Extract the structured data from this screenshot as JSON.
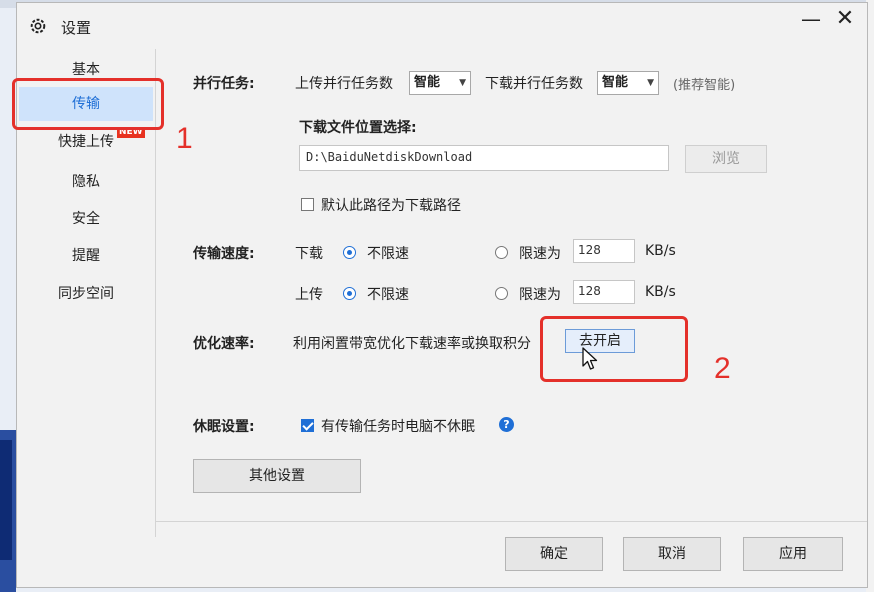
{
  "window": {
    "title": "设置"
  },
  "sidebar": {
    "items": [
      {
        "label": "基本"
      },
      {
        "label": "传输"
      },
      {
        "label": "快捷上传",
        "badge": "NEW"
      },
      {
        "label": "隐私"
      },
      {
        "label": "安全"
      },
      {
        "label": "提醒"
      },
      {
        "label": "同步空间"
      }
    ],
    "active": "传输"
  },
  "parallel": {
    "label": "并行任务:",
    "upload_label": "上传并行任务数",
    "upload_value": "智能",
    "download_label": "下载并行任务数",
    "download_value": "智能",
    "hint": "(推荐智能)"
  },
  "download_location": {
    "label": "下载文件位置选择:",
    "path": "D:\\BaiduNetdiskDownload",
    "browse_label": "浏览",
    "default_checkbox_label": "默认此路径为下载路径",
    "default_checked": false
  },
  "speed": {
    "label": "传输速度:",
    "download": {
      "label": "下载",
      "unlimited": "不限速",
      "limit_label": "限速为",
      "limit_value": "128",
      "unit": "KB/s"
    },
    "upload": {
      "label": "上传",
      "unlimited": "不限速",
      "limit_label": "限速为",
      "limit_value": "128",
      "unit": "KB/s"
    }
  },
  "optimize": {
    "label": "优化速率:",
    "desc": "利用闲置带宽优化下载速率或换取积分",
    "button": "去开启"
  },
  "sleep": {
    "label": "休眠设置:",
    "checkbox_label": "有传输任务时电脑不休眠",
    "checked": true,
    "help_glyph": "?"
  },
  "other_settings_label": "其他设置",
  "footer": {
    "ok": "确定",
    "cancel": "取消",
    "apply": "应用"
  },
  "annotations": {
    "one": "1",
    "two": "2"
  },
  "colors": {
    "accent": "#1f6fd6",
    "annotation": "#e4302a",
    "active_bg": "#cfe3fb"
  }
}
